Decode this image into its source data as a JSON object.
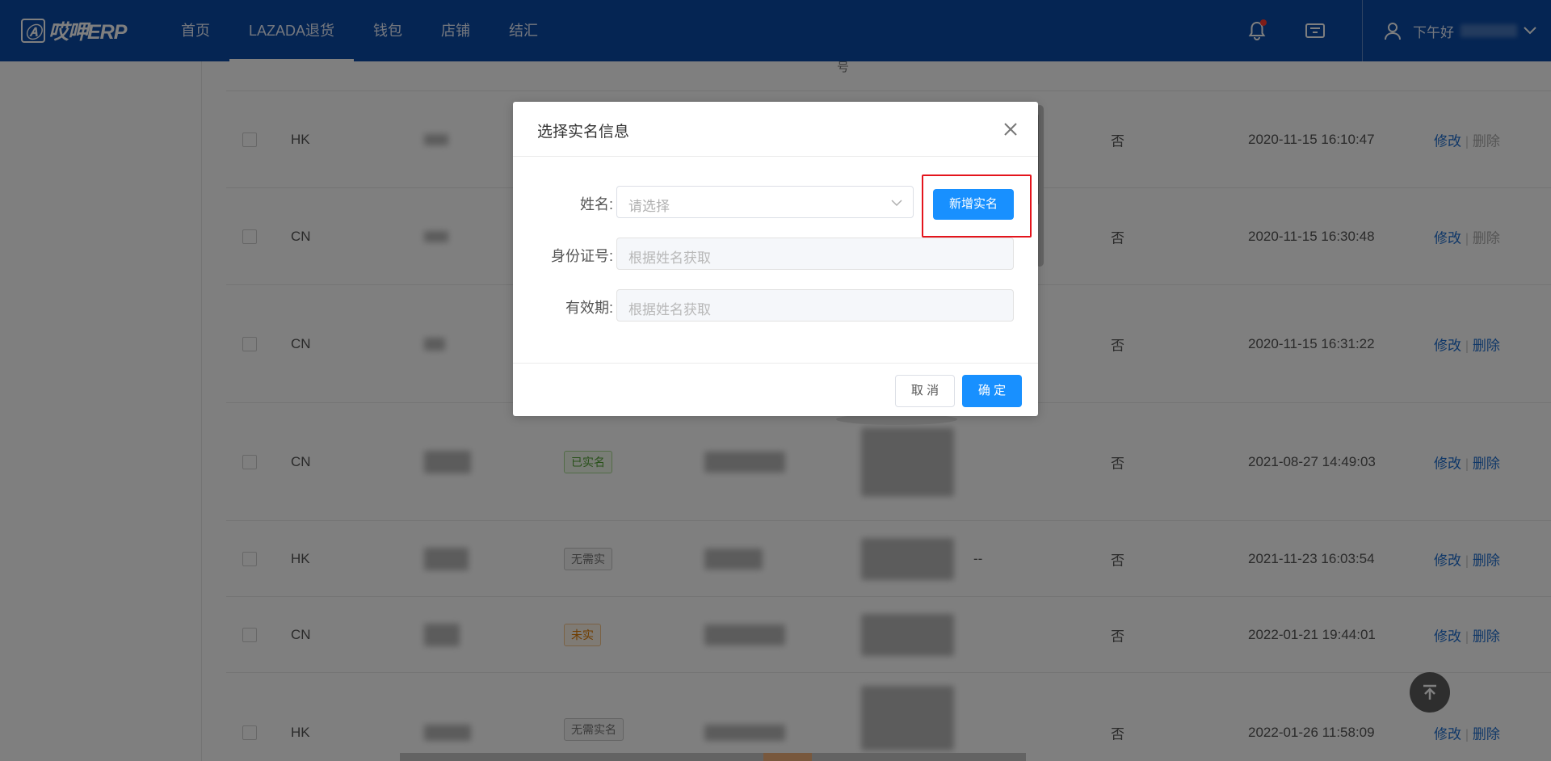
{
  "app": {
    "logo_text": "哎呷ERP"
  },
  "nav": {
    "items": [
      "首页",
      "LAZADA退货",
      "钱包",
      "店铺",
      "结汇"
    ],
    "active_index": 1
  },
  "header": {
    "greeting": "下午好",
    "icons": [
      "bell-icon",
      "message-icon",
      "user-icon",
      "chevron-down-icon"
    ]
  },
  "table": {
    "header_fragment": "号",
    "rows": [
      {
        "region": "HK",
        "tag": "",
        "tag_style": "",
        "extra": "",
        "default": "否",
        "time": "2020-11-15 16:10:47",
        "edit": "修改",
        "delete": "删除",
        "delete_enabled": false
      },
      {
        "region": "CN",
        "tag": "",
        "tag_style": "",
        "extra": "",
        "default": "否",
        "time": "2020-11-15 16:30:48",
        "edit": "修改",
        "delete": "删除",
        "delete_enabled": false
      },
      {
        "region": "CN",
        "tag": "",
        "tag_style": "",
        "extra": "",
        "default": "否",
        "time": "2020-11-15 16:31:22",
        "edit": "修改",
        "delete": "删除",
        "delete_enabled": true
      },
      {
        "region": "CN",
        "tag": "已实名",
        "tag_style": "green",
        "extra": "",
        "default": "否",
        "time": "2021-08-27 14:49:03",
        "edit": "修改",
        "delete": "删除",
        "delete_enabled": true
      },
      {
        "region": "HK",
        "tag": "无需实",
        "tag_style": "gray",
        "extra": "--",
        "default": "否",
        "time": "2021-11-23 16:03:54",
        "edit": "修改",
        "delete": "删除",
        "delete_enabled": true
      },
      {
        "region": "CN",
        "tag": "未实",
        "tag_style": "orange",
        "extra": "",
        "default": "否",
        "time": "2022-01-21 19:44:01",
        "edit": "修改",
        "delete": "删除",
        "delete_enabled": true
      },
      {
        "region": "HK",
        "tag": "无需实名",
        "tag_style": "gray",
        "extra": "",
        "default": "否",
        "time": "2022-01-26 11:58:09",
        "edit": "修改",
        "delete": "删除",
        "delete_enabled": true
      }
    ]
  },
  "dialog": {
    "title": "选择实名信息",
    "name_label": "姓名:",
    "name_placeholder": "请选择",
    "add_button": "新增实名",
    "id_label": "身份证号:",
    "id_placeholder": "根据姓名获取",
    "expiry_label": "有效期:",
    "expiry_placeholder": "根据姓名获取",
    "cancel": "取 消",
    "confirm": "确 定"
  },
  "colors": {
    "nav_bg": "#0a4aa6",
    "primary": "#1890ff",
    "highlight": "#e4141c",
    "link": "#1f6fd1"
  }
}
